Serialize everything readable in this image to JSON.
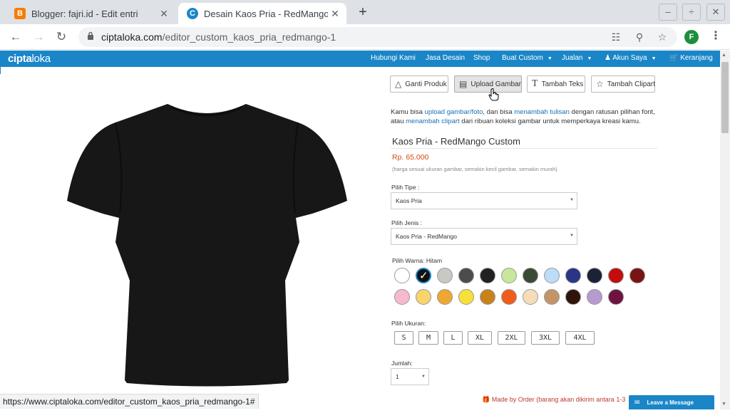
{
  "browser": {
    "tabs": [
      {
        "title": "Blogger: fajri.id - Edit entri",
        "favicon": "blogger-icon",
        "color": "#f57c00"
      },
      {
        "title": "Desain Kaos Pria - RedMango C",
        "favicon": "ciptaloka-icon",
        "color": "#1a86c8"
      }
    ],
    "new_tab": "+",
    "window": {
      "minimize": "–",
      "restore": "÷",
      "close": "✕"
    },
    "url_host": "ciptaloka.com",
    "url_path": "/editor_custom_kaos_pria_redmango-1",
    "profile_initial": "F",
    "status_url": "https://www.ciptaloka.com/editor_custom_kaos_pria_redmango-1#"
  },
  "site": {
    "logo_bold": "cipta",
    "logo_rest": "loka",
    "nav": [
      {
        "label": "Hubungi Kami"
      },
      {
        "label": "Jasa Desain"
      },
      {
        "label": "Shop"
      },
      {
        "label": "Buat Custom"
      },
      {
        "label": "Jualan"
      },
      {
        "label": "Akun Saya"
      },
      {
        "label": "Keranjang"
      }
    ]
  },
  "editor": {
    "tools": [
      {
        "label": "Ganti Produk",
        "icon": "shirt-icon"
      },
      {
        "label": "Upload Gambar",
        "icon": "image-icon"
      },
      {
        "label": "Tambah Teks",
        "icon": "text-icon"
      },
      {
        "label": "Tambah Clipart",
        "icon": "star-icon"
      }
    ],
    "desc": {
      "p1": "Kamu bisa ",
      "l1": "upload gambar/foto",
      "p2": ", dan bisa ",
      "l2": "menambah tulisan",
      "p3": " dengan ratusan pilihan font, atau ",
      "l3": "menambah clipart",
      "p4": " dari ribuan koleksi gambar untuk memperkaya kreasi kamu."
    }
  },
  "product": {
    "title": "Kaos Pria - RedMango Custom",
    "price": "Rp. 65.000",
    "price_note": "(harga sesuai ukuran gambar, semakin kecil gambar, semakin murah)",
    "tipe_label": "Pilih Tipe :",
    "tipe_value": "Kaos Pria",
    "jenis_label": "Pilih Jenis :",
    "jenis_value": "Kaos Pria - RedMango",
    "warna_label": "Pilih Warna: Hitam",
    "colors_row1": [
      "#ffffff",
      "#111111",
      "#c9c9c4",
      "#4a4d4a",
      "#222022",
      "#c7e89a",
      "#3b4a36",
      "#bcdcf7",
      "#2a3585",
      "#1c2236",
      "#c40c0c",
      "#7a1414"
    ],
    "colors_row2": [
      "#f7b9cf",
      "#f9d36b",
      "#eda732",
      "#f7e03a",
      "#c9811a",
      "#f05c1c",
      "#f7dcb9",
      "#c49468",
      "#2e1409",
      "#b69ad0",
      "#6e1340"
    ],
    "selected_color_index": 1,
    "ukuran_label": "Pilih Ukuran:",
    "sizes": [
      "S",
      "M",
      "L",
      "XL",
      "2XL",
      "3XL",
      "4XL"
    ],
    "jumlah_label": "Jumlah:",
    "jumlah_value": "1",
    "made_order": "Made by Order (barang akan dikirim antara 1-3"
  },
  "chat": {
    "label": "Leave a Message"
  }
}
